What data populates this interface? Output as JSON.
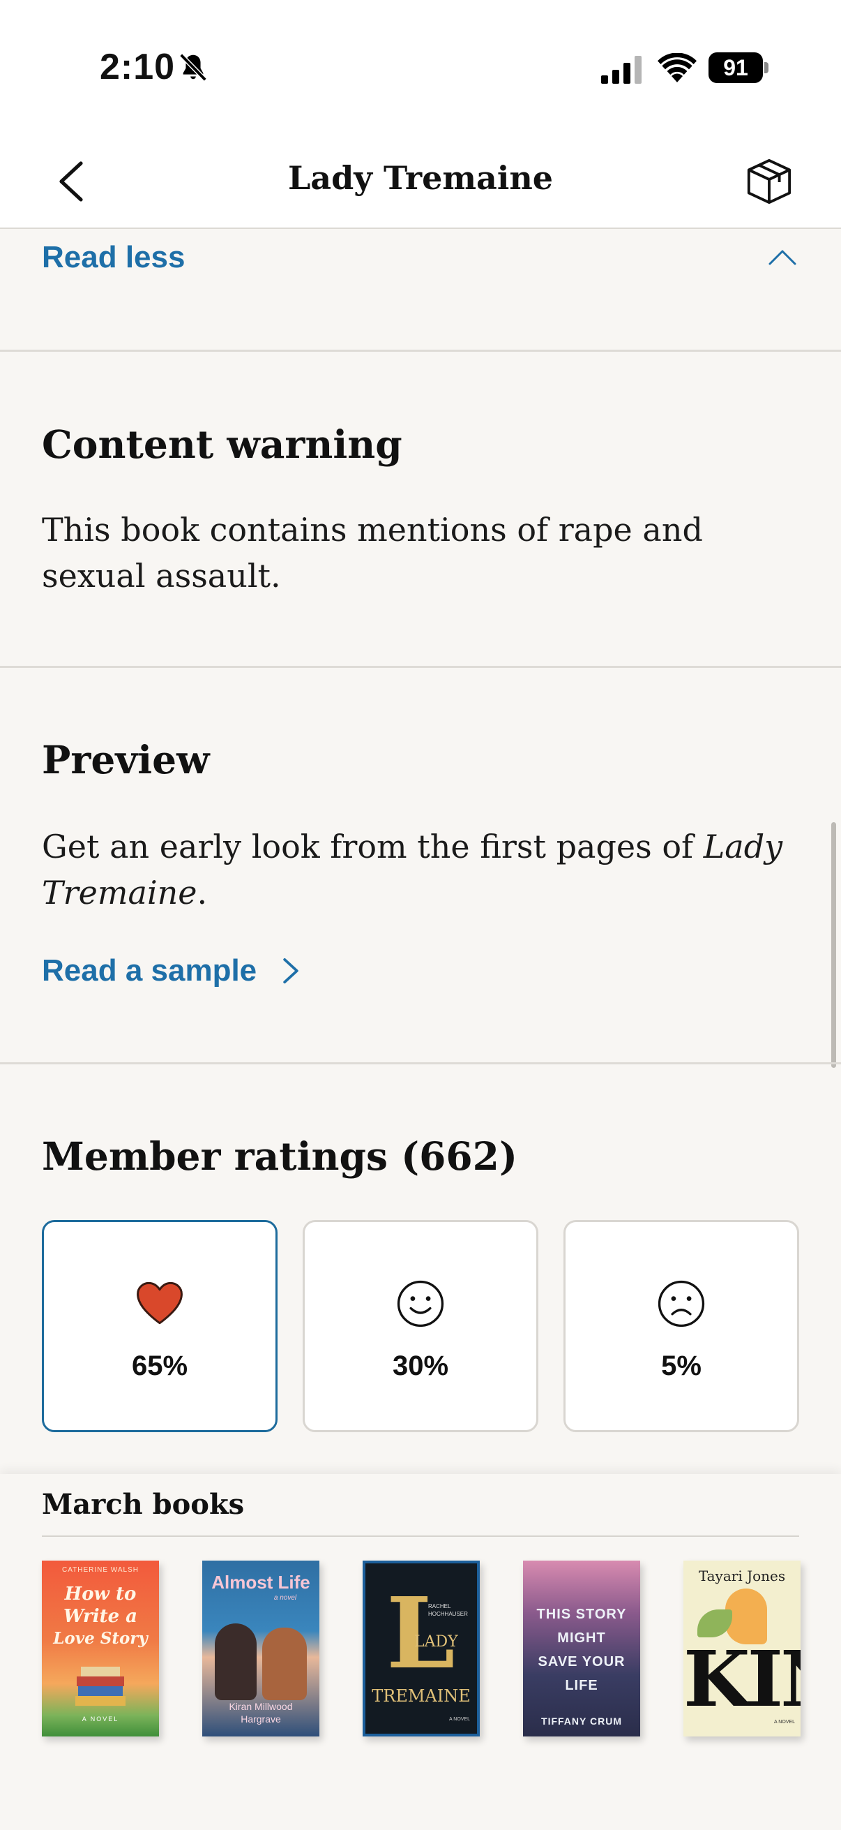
{
  "status_bar": {
    "time": "2:10",
    "battery": "91"
  },
  "nav": {
    "title": "Lady Tremaine"
  },
  "description": {
    "read_less": "Read less"
  },
  "content_warning": {
    "heading": "Content warning",
    "text_line1": "This book contains mentions of rape and",
    "text_line2": "sexual assault."
  },
  "preview": {
    "heading": "Preview",
    "text_line1_plain": "Get an early look from the first pages of ",
    "text_line1_italic": "Lady",
    "text_line2_italic": "Tremaine",
    "text_line2_end": ".",
    "read_sample": "Read a sample"
  },
  "ratings": {
    "heading": "Member ratings (662)",
    "items": [
      {
        "icon": "heart-icon",
        "pct": "65%"
      },
      {
        "icon": "smile-icon",
        "pct": "30%"
      },
      {
        "icon": "frown-icon",
        "pct": "5%"
      }
    ]
  },
  "march_books": {
    "title": "March books",
    "books": [
      {
        "author": "CATHERINE WALSH",
        "title_l1": "How to",
        "title_l2": "Write a",
        "title_l3": "Love Story",
        "sub": "A NOVEL"
      },
      {
        "title": "Almost Life",
        "sub": "a novel",
        "author_l1": "Kiran Millwood",
        "author_l2": "Hargrave"
      },
      {
        "author_l1": "RACHEL",
        "author_l2": "HOCHHAUSER",
        "title_l1": "LADY",
        "title_l2": "TREMAINE",
        "sub": "A NOVEL"
      },
      {
        "title_l1": "THIS STORY",
        "title_l2": "MIGHT",
        "title_l3": "SAVE YOUR",
        "title_l4": "LIFE",
        "author": "TIFFANY CRUM"
      },
      {
        "author": "Tayari Jones",
        "title": "KIN",
        "sub": "A NOVEL"
      }
    ]
  },
  "colors": {
    "accent_link": "#1e6fa8",
    "selected_border": "#1d6b9c",
    "heart": "#d9482b"
  }
}
